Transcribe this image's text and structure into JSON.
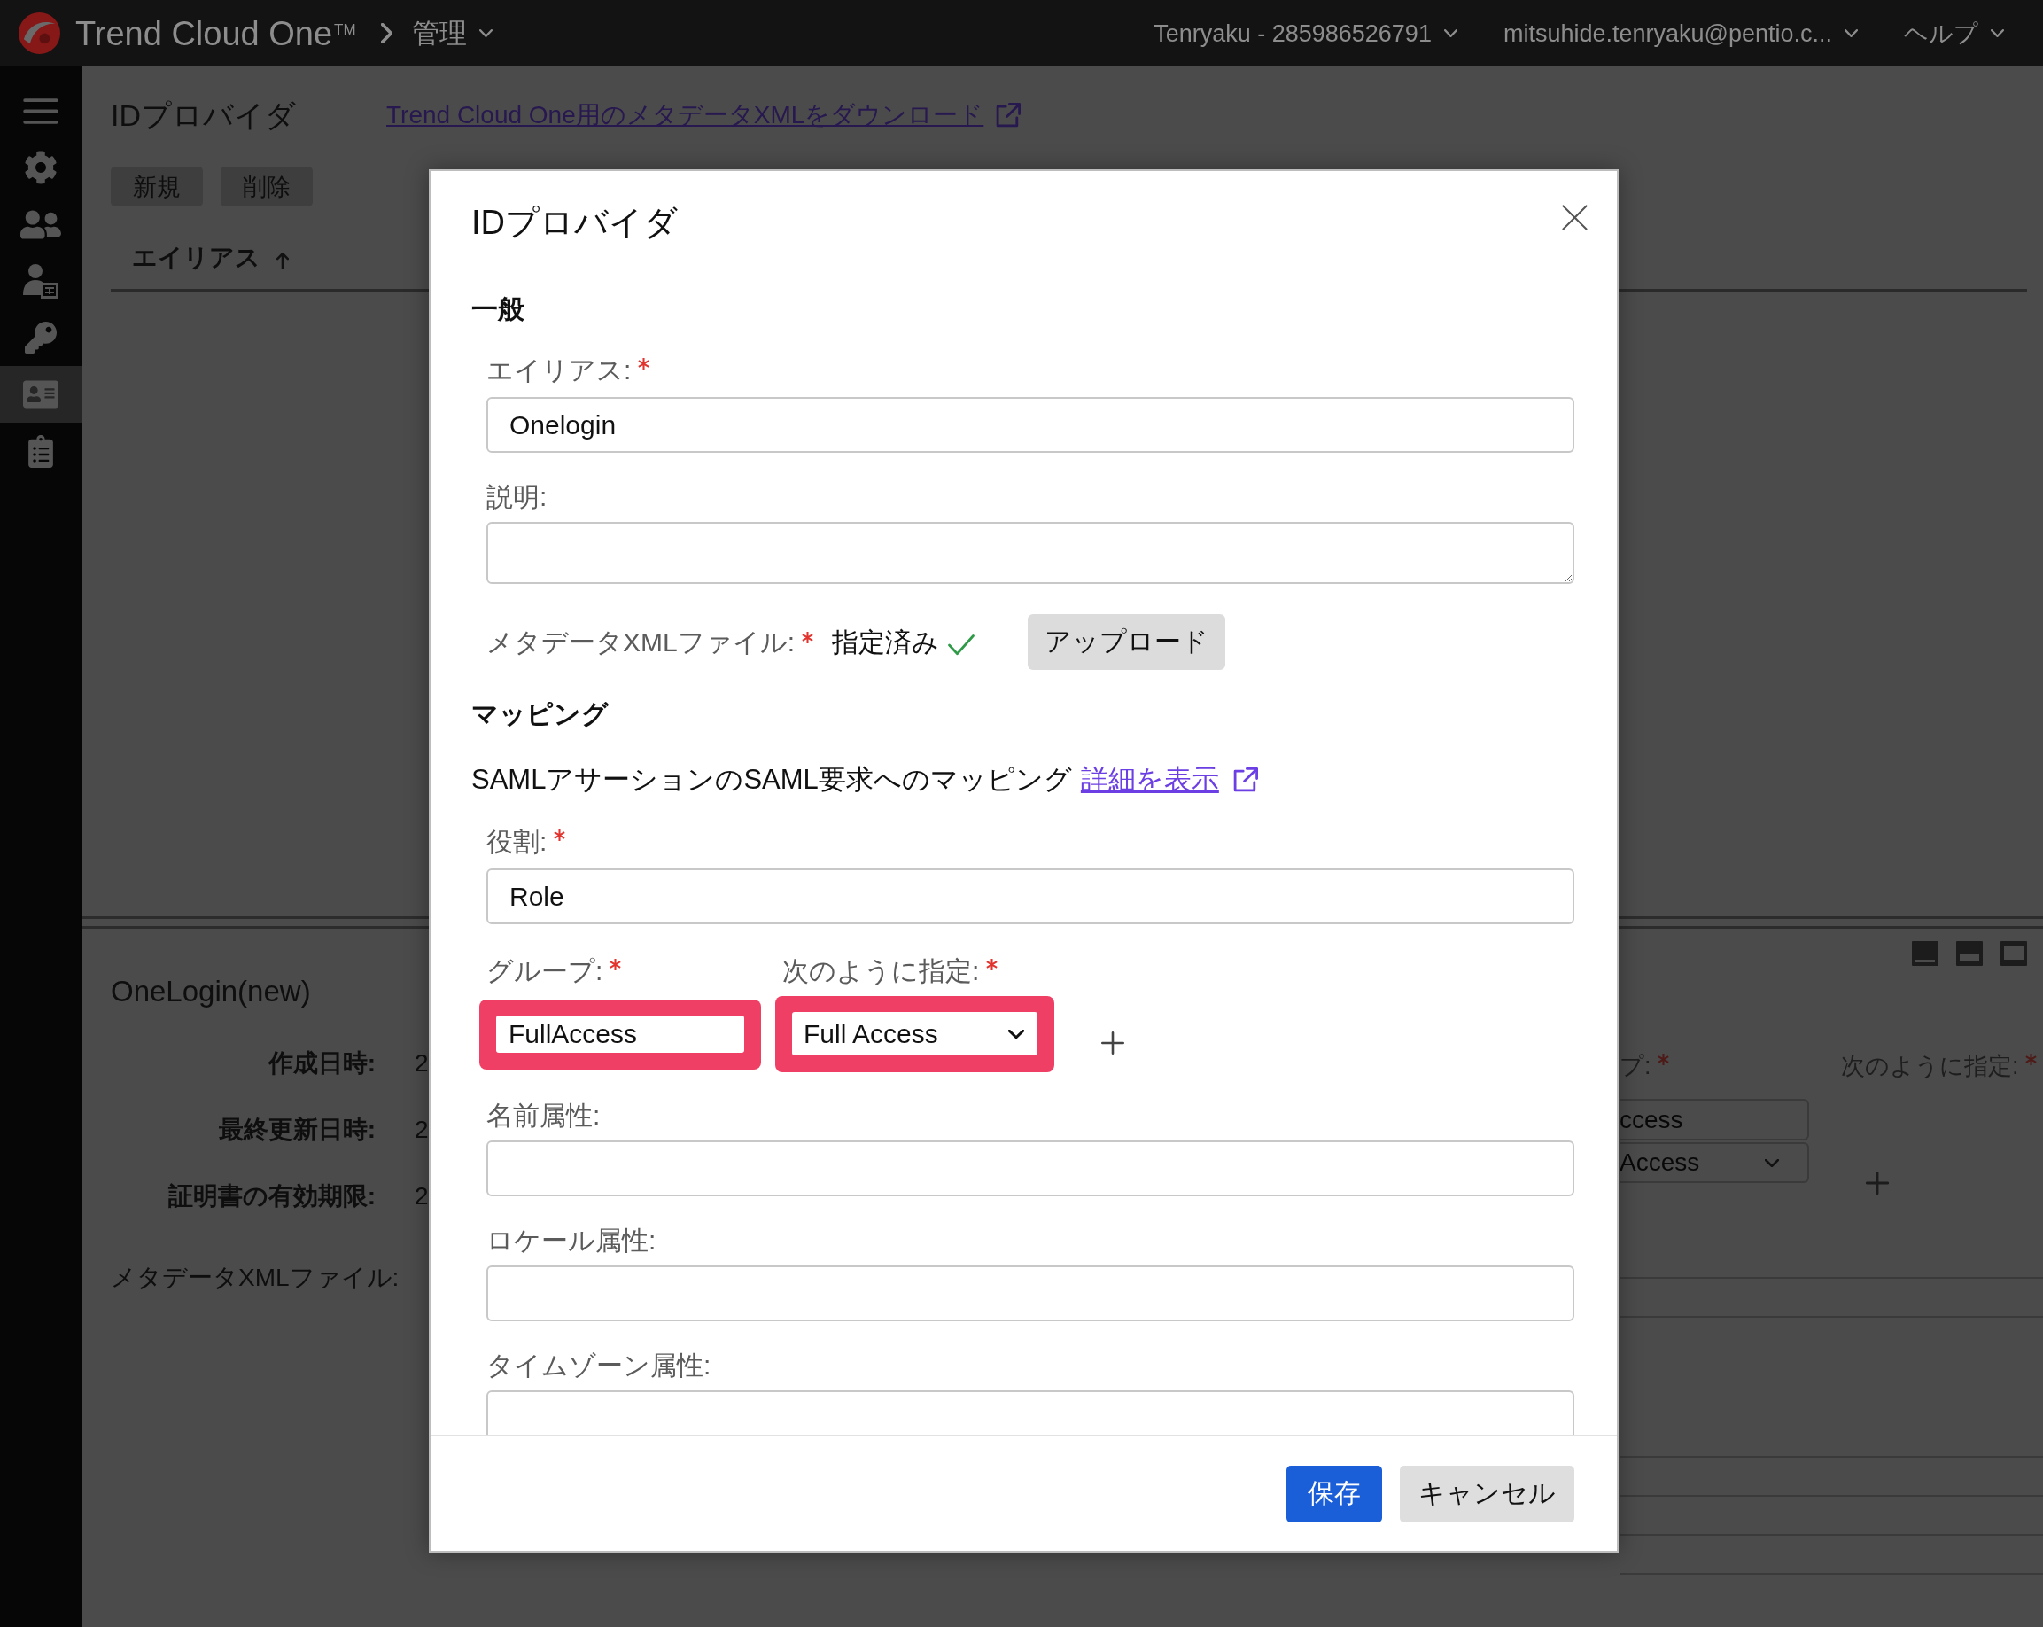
{
  "top_bar": {
    "product": "Trend Cloud One$^{TM}$",
    "section": "管理",
    "account": "Tenryaku - 285986526791",
    "user": "mitsuhide.tenryaku@pentio.c...",
    "help": "ヘルプ"
  },
  "sidebar": {
    "items": [
      {
        "selected": false
      },
      {
        "selected": false
      },
      {
        "selected": false
      },
      {
        "selected": false
      },
      {
        "selected": false
      },
      {
        "selected": true
      },
      {
        "selected": false
      }
    ]
  },
  "page": {
    "title": "IDプロバイダ",
    "download_link": "Trend Cloud One用のメタデータXMLをダウンロード",
    "actions": [
      "新規",
      "削除"
    ],
    "table": {
      "columns": [
        {
          "label": "エイリアス",
          "ascending": true
        }
      ]
    }
  },
  "detail": {
    "title": "OneLogin(new)",
    "fields": [
      {
        "label": "作成日時:",
        "value": "2"
      },
      {
        "label": "最終更新日時:",
        "value": "2"
      },
      {
        "label": "証明書の有効期限:",
        "value": "2"
      }
    ],
    "metadata_label": "メタデータXMLファイル:",
    "group": {
      "label": "プ:",
      "required": true,
      "value": "ccess"
    },
    "specify": {
      "label": "次のように指定:",
      "required": true,
      "value": "Access"
    }
  },
  "dialog": {
    "title": "IDプロバイダ",
    "general": {
      "heading": "一般",
      "fields": [
        {
          "kind": "text",
          "label": "エイリアス:",
          "required": true,
          "value": "Onelogin"
        },
        {
          "kind": "textarea",
          "label": "説明:"
        }
      ],
      "metadata": {
        "label": "メタデータXMLファイル:",
        "required": true,
        "status": "指定済み",
        "uploaded": true,
        "button": "アップロード"
      }
    },
    "mapping": {
      "heading": "マッピング",
      "description": "SAMLアサーションのSAML要求へのマッピング",
      "details_link": "詳細を表示",
      "role": {
        "label": "役割:",
        "required": true,
        "value": "Role"
      },
      "group": {
        "label": "グループ:",
        "required": true,
        "value": "FullAccess",
        "highlighted": true
      },
      "specify": {
        "label": "次のように指定:",
        "required": true,
        "value": "Full Access",
        "highlighted": true
      },
      "attributes": [
        {
          "label": "名前属性:"
        },
        {
          "label": "ロケール属性:"
        },
        {
          "label": "タイムゾーン属性:"
        }
      ]
    },
    "buttons": [
      {
        "label": "保存",
        "kind": "primary"
      },
      {
        "label": "キャンセル",
        "kind": "secondary"
      }
    ]
  }
}
